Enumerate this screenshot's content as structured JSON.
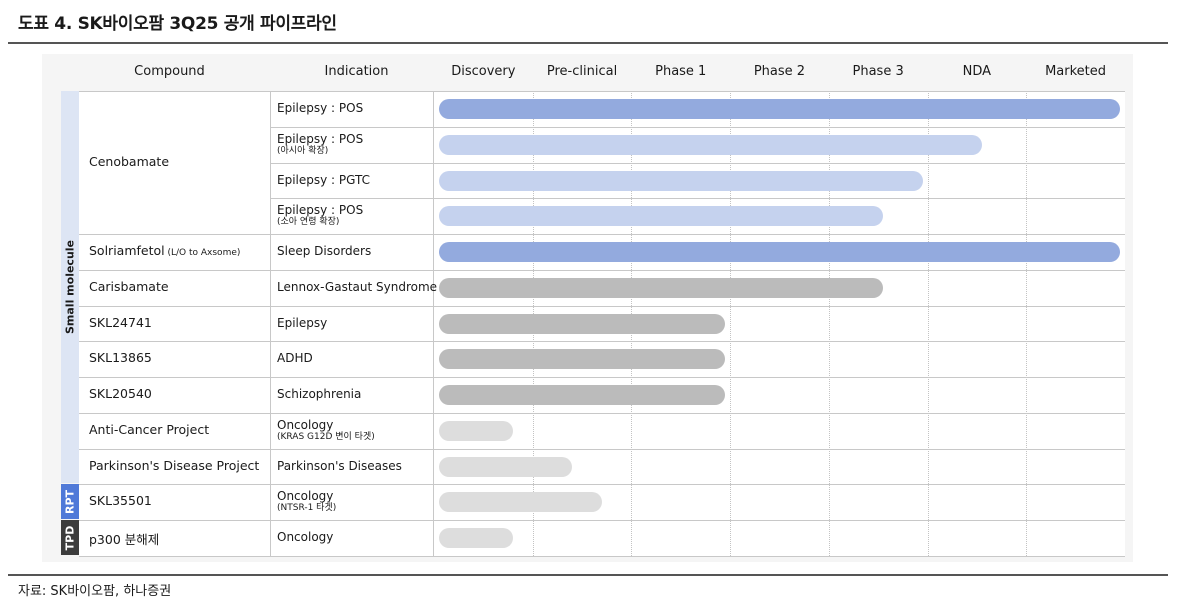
{
  "title": "도표 4. SK바이오팜 3Q25 공개 파이프라인",
  "source": "자료: SK바이오팜, 하나증권",
  "headers": {
    "compound": "Compound",
    "indication": "Indication",
    "stages": [
      "Discovery",
      "Pre-clinical",
      "Phase 1",
      "Phase 2",
      "Phase 3",
      "NDA",
      "Marketed"
    ]
  },
  "categories": [
    {
      "label": "Small molecule",
      "color": "#dde5f4",
      "text_color": "#1a1a1a"
    },
    {
      "label": "RPT",
      "color": "#4f79d8",
      "text_color": "#ffffff"
    },
    {
      "label": "TPD",
      "color": "#3c3c3c",
      "text_color": "#ffffff"
    }
  ],
  "compounds": [
    {
      "name": "Cenobamate",
      "note": ""
    },
    {
      "name": "Solriamfetol",
      "note": "(L/O to Axsome)"
    },
    {
      "name": "Carisbamate",
      "note": ""
    },
    {
      "name": "SKL24741",
      "note": ""
    },
    {
      "name": "SKL13865",
      "note": ""
    },
    {
      "name": "SKL20540",
      "note": ""
    },
    {
      "name": "Anti-Cancer Project",
      "note": ""
    },
    {
      "name": "Parkinson's Disease Project",
      "note": ""
    },
    {
      "name": "SKL35501",
      "note": ""
    },
    {
      "name": "p300 분해제",
      "note": ""
    }
  ],
  "rows": [
    {
      "indication": "Epilepsy : POS",
      "indication_sub": "",
      "progress_stages": 7.0,
      "color": "#93aade"
    },
    {
      "indication": "Epilepsy : POS",
      "indication_sub": "(아시아 확장)",
      "progress_stages": 5.6,
      "color": "#c5d2ee"
    },
    {
      "indication": "Epilepsy : PGTC",
      "indication_sub": "",
      "progress_stages": 5.0,
      "color": "#c5d2ee"
    },
    {
      "indication": "Epilepsy : POS",
      "indication_sub": "(소아 연령 확장)",
      "progress_stages": 4.6,
      "color": "#c5d2ee"
    },
    {
      "indication": "Sleep Disorders",
      "indication_sub": "",
      "progress_stages": 7.0,
      "color": "#93aade"
    },
    {
      "indication": "Lennox-Gastaut Syndrome",
      "indication_sub": "",
      "progress_stages": 4.6,
      "color": "#bbbbbb"
    },
    {
      "indication": "Epilepsy",
      "indication_sub": "",
      "progress_stages": 3.0,
      "color": "#bbbbbb"
    },
    {
      "indication": "ADHD",
      "indication_sub": "",
      "progress_stages": 3.0,
      "color": "#bbbbbb"
    },
    {
      "indication": "Schizophrenia",
      "indication_sub": "",
      "progress_stages": 3.0,
      "color": "#bbbbbb"
    },
    {
      "indication": "Oncology",
      "indication_sub": "(KRAS G12D 변이 타겟)",
      "progress_stages": 0.85,
      "color": "#dddddd"
    },
    {
      "indication": "Parkinson's Diseases",
      "indication_sub": "",
      "progress_stages": 1.45,
      "color": "#dddddd"
    },
    {
      "indication": "Oncology",
      "indication_sub": "(NTSR-1 타겟)",
      "progress_stages": 1.75,
      "color": "#dddddd"
    },
    {
      "indication": "Oncology",
      "indication_sub": "",
      "progress_stages": 0.85,
      "color": "#dddddd"
    }
  ]
}
